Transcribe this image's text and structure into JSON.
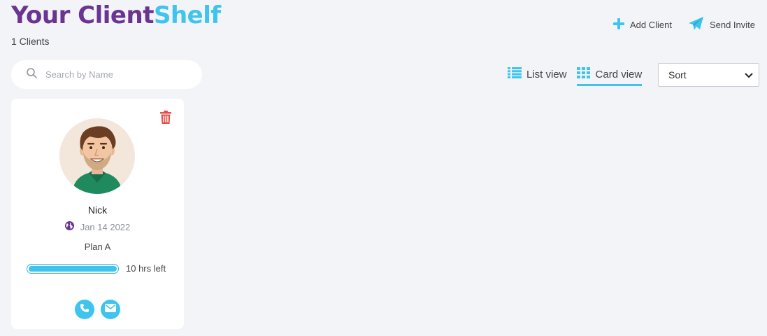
{
  "header": {
    "title_part1": "Your Client",
    "title_part2": "Shelf",
    "client_count": "1 Clients",
    "add_client_label": "Add Client",
    "send_invite_label": "Send Invite"
  },
  "search": {
    "placeholder": "Search by Name",
    "value": ""
  },
  "view": {
    "list_label": "List view",
    "card_label": "Card view",
    "active": "card"
  },
  "sort": {
    "selected": "Sort"
  },
  "clients": [
    {
      "name": "Nick",
      "date": "Jan 14 2022",
      "plan": "Plan A",
      "hours_left_label": "10 hrs left",
      "progress": 1.0
    }
  ],
  "colors": {
    "title_purple": "#6a3493",
    "accent_blue": "#3ec4ee",
    "delete_red": "#e0524f",
    "globe_purple": "#6a3493"
  },
  "icons": {
    "add_client": "plus-icon",
    "send_invite": "paper-plane-icon",
    "search": "search-icon",
    "list_view": "list-icon",
    "card_view": "grid-icon",
    "sort": "chevron-down-icon",
    "delete": "trash-icon",
    "date": "globe-icon",
    "phone": "phone-icon",
    "email": "envelope-icon"
  }
}
